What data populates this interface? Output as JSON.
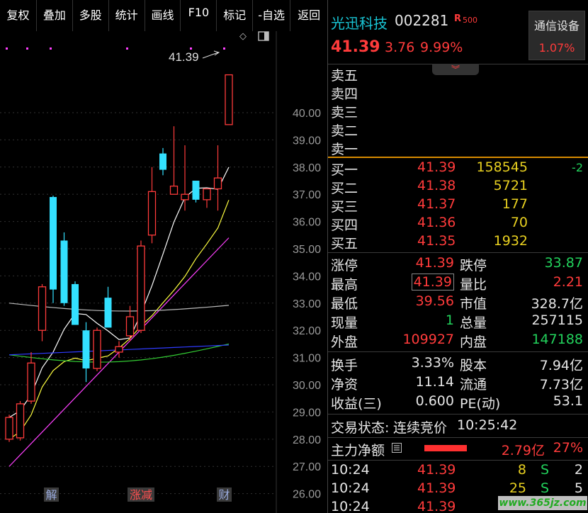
{
  "toolbar": {
    "buttons": [
      "复权",
      "叠加",
      "多股",
      "统计",
      "画线",
      "F10",
      "标记",
      "-自选",
      "返回"
    ]
  },
  "chart": {
    "price_labels": [
      "40.00",
      "39.00",
      "38.00",
      "37.00",
      "36.00",
      "35.00",
      "34.00",
      "33.00",
      "32.00",
      "31.00",
      "30.00",
      "29.00",
      "28.00",
      "27.00",
      "26.00"
    ],
    "last_price_note": "41.39",
    "event_markers": [
      "解",
      "涨减",
      "财"
    ],
    "colors": {
      "up": "#ff3b3b",
      "down": "#33e0ff",
      "ma5": "#ffffff",
      "ma10": "#ffff40",
      "ma20": "#ff40ff",
      "ma60": "#33cc33",
      "ma120": "#2f3bff",
      "ma250": "#bbbbbb"
    }
  },
  "chart_data": {
    "type": "candlestick",
    "y_range": [
      25.6,
      41.9
    ],
    "candles": [
      {
        "o": 28.0,
        "h": 28.9,
        "l": 27.9,
        "c": 28.8
      },
      {
        "o": 28.05,
        "h": 29.4,
        "l": 27.95,
        "c": 29.3
      },
      {
        "o": 29.4,
        "h": 31.2,
        "l": 29.3,
        "c": 30.8
      },
      {
        "o": 32.0,
        "h": 33.7,
        "l": 31.6,
        "c": 33.6
      },
      {
        "o": 36.9,
        "h": 36.95,
        "l": 33.0,
        "c": 33.5
      },
      {
        "o": 35.3,
        "h": 35.6,
        "l": 32.9,
        "c": 33.0
      },
      {
        "o": 33.7,
        "h": 33.8,
        "l": 32.6,
        "c": 32.2
      },
      {
        "o": 32.0,
        "h": 32.3,
        "l": 30.1,
        "c": 30.6
      },
      {
        "o": 30.6,
        "h": 32.1,
        "l": 30.5,
        "c": 32.0
      },
      {
        "o": 33.2,
        "h": 33.6,
        "l": 32.5,
        "c": 32.1
      },
      {
        "o": 31.2,
        "h": 31.6,
        "l": 31.0,
        "c": 31.4
      },
      {
        "o": 31.8,
        "h": 32.9,
        "l": 31.6,
        "c": 32.5
      },
      {
        "o": 32.0,
        "h": 35.3,
        "l": 31.9,
        "c": 35.1
      },
      {
        "o": 35.5,
        "h": 38.0,
        "l": 35.2,
        "c": 37.1
      },
      {
        "o": 38.5,
        "h": 38.7,
        "l": 37.7,
        "c": 37.9
      },
      {
        "o": 37.0,
        "h": 39.5,
        "l": 37.0,
        "c": 37.3
      },
      {
        "o": 36.8,
        "h": 38.8,
        "l": 36.4,
        "c": 37.0
      },
      {
        "o": 37.5,
        "h": 37.5,
        "l": 36.7,
        "c": 36.8
      },
      {
        "o": 36.8,
        "h": 37.2,
        "l": 36.5,
        "c": 37.2
      },
      {
        "o": 37.2,
        "h": 38.8,
        "l": 36.4,
        "c": 37.6
      },
      {
        "o": 39.56,
        "h": 41.39,
        "l": 39.56,
        "c": 41.39
      }
    ]
  },
  "stock": {
    "name": "光迅科技",
    "code": "002281",
    "badge": "R",
    "badge_num": "500",
    "price": "41.39",
    "change": "3.76",
    "change_pct": "9.99%",
    "sector_name": "通信设备",
    "sector_pct": "1.07%"
  },
  "order_book": {
    "asks": [
      {
        "label": "卖五"
      },
      {
        "label": "卖四"
      },
      {
        "label": "卖三"
      },
      {
        "label": "卖二"
      },
      {
        "label": "卖一"
      }
    ],
    "bids": [
      {
        "label": "买一",
        "price": "41.39",
        "vol": "158545",
        "chg": "-2"
      },
      {
        "label": "买二",
        "price": "41.38",
        "vol": "5721",
        "chg": ""
      },
      {
        "label": "买三",
        "price": "41.37",
        "vol": "177",
        "chg": ""
      },
      {
        "label": "买四",
        "price": "41.36",
        "vol": "70",
        "chg": ""
      },
      {
        "label": "买五",
        "price": "41.35",
        "vol": "1932",
        "chg": ""
      }
    ]
  },
  "stats": {
    "limit_up_label": "涨停",
    "limit_up": "41.39",
    "limit_down_label": "跌停",
    "limit_down": "33.87",
    "high_label": "最高",
    "high": "41.39",
    "vol_ratio_label": "量比",
    "vol_ratio": "2.21",
    "low_label": "最低",
    "low": "39.56",
    "mkt_cap_label": "市值",
    "mkt_cap": "328.7亿",
    "cur_vol_label": "现量",
    "cur_vol": "1",
    "total_vol_label": "总量",
    "total_vol": "257115",
    "outer_label": "外盘",
    "outer": "109927",
    "inner_label": "内盘",
    "inner": "147188",
    "turnover_label": "换手",
    "turnover": "3.33%",
    "shares_label": "股本",
    "shares": "7.94亿",
    "nav_label": "净资",
    "nav": "11.14",
    "float_label": "流通",
    "float": "7.73亿",
    "eps_label": "收益(三)",
    "eps": "0.600",
    "pe_label": "PE(动)",
    "pe": "53.1",
    "trade_status_label": "交易状态:",
    "trade_status": "连续竞价",
    "trade_time": "10:25:42",
    "main_flow_label": "主力净额",
    "main_flow_value": "2.79亿",
    "main_flow_pct": "27%"
  },
  "ticks": [
    {
      "time": "10:24",
      "price": "41.39",
      "vol": "8",
      "side": "S",
      "count": "2"
    },
    {
      "time": "10:24",
      "price": "41.39",
      "vol": "25",
      "side": "S",
      "count": "5"
    },
    {
      "time": "10:24",
      "price": "41.39",
      "vol": "",
      "side": "",
      "count": ""
    }
  ],
  "watermark": "www.365jz.com"
}
